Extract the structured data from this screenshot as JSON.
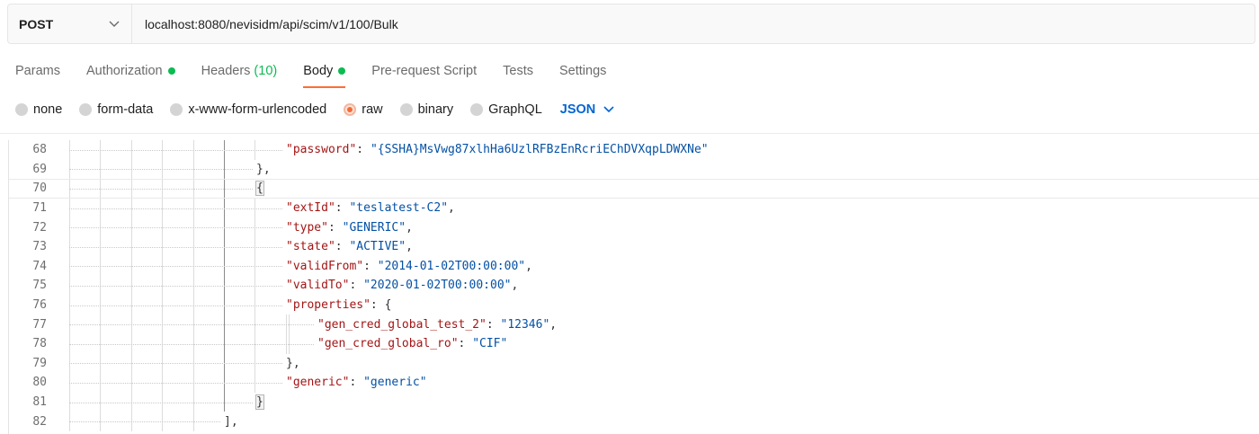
{
  "request": {
    "method": "POST",
    "url": "localhost:8080/nevisidm/api/scim/v1/100/Bulk"
  },
  "tabs": [
    {
      "label": "Params"
    },
    {
      "label": "Authorization",
      "dot": true
    },
    {
      "label": "Headers",
      "count": "(10)"
    },
    {
      "label": "Body",
      "dot": true,
      "active": true
    },
    {
      "label": "Pre-request Script"
    },
    {
      "label": "Tests"
    },
    {
      "label": "Settings"
    }
  ],
  "body_types": [
    {
      "label": "none"
    },
    {
      "label": "form-data"
    },
    {
      "label": "x-www-form-urlencoded"
    },
    {
      "label": "raw",
      "selected": true
    },
    {
      "label": "binary"
    },
    {
      "label": "GraphQL"
    }
  ],
  "format": "JSON",
  "editor": {
    "lines": [
      {
        "n": "68",
        "indent": 4,
        "tokens": [
          [
            "k",
            "\"password\""
          ],
          [
            "p",
            ": "
          ],
          [
            "s",
            "\"{SSHA}MsVwg87xlhHa6UzlRFBzEnRcriEChDVXqpLDWXNe\""
          ]
        ]
      },
      {
        "n": "69",
        "indent": 3,
        "tokens": [
          [
            "p",
            "},"
          ]
        ]
      },
      {
        "n": "70",
        "indent": 3,
        "tokens": [
          [
            "b",
            "{"
          ]
        ],
        "current": true
      },
      {
        "n": "71",
        "indent": 4,
        "tokens": [
          [
            "k",
            "\"extId\""
          ],
          [
            "p",
            ": "
          ],
          [
            "s",
            "\"teslatest-C2\""
          ],
          [
            "p",
            ","
          ]
        ]
      },
      {
        "n": "72",
        "indent": 4,
        "tokens": [
          [
            "k",
            "\"type\""
          ],
          [
            "p",
            ": "
          ],
          [
            "s",
            "\"GENERIC\""
          ],
          [
            "p",
            ","
          ]
        ]
      },
      {
        "n": "73",
        "indent": 4,
        "tokens": [
          [
            "k",
            "\"state\""
          ],
          [
            "p",
            ": "
          ],
          [
            "s",
            "\"ACTIVE\""
          ],
          [
            "p",
            ","
          ]
        ]
      },
      {
        "n": "74",
        "indent": 4,
        "tokens": [
          [
            "k",
            "\"validFrom\""
          ],
          [
            "p",
            ": "
          ],
          [
            "s",
            "\"2014-01-02T00:00:00\""
          ],
          [
            "p",
            ","
          ]
        ]
      },
      {
        "n": "75",
        "indent": 4,
        "tokens": [
          [
            "k",
            "\"validTo\""
          ],
          [
            "p",
            ": "
          ],
          [
            "s",
            "\"2020-01-02T00:00:00\""
          ],
          [
            "p",
            ","
          ]
        ]
      },
      {
        "n": "76",
        "indent": 4,
        "tokens": [
          [
            "k",
            "\"properties\""
          ],
          [
            "p",
            ": {"
          ]
        ]
      },
      {
        "n": "77",
        "indent": 5,
        "tokens": [
          [
            "k",
            "\"gen_cred_global_test_2\""
          ],
          [
            "p",
            ": "
          ],
          [
            "s",
            "\"12346\""
          ],
          [
            "p",
            ","
          ]
        ]
      },
      {
        "n": "78",
        "indent": 5,
        "tokens": [
          [
            "k",
            "\"gen_cred_global_ro\""
          ],
          [
            "p",
            ": "
          ],
          [
            "s",
            "\"CIF\""
          ]
        ]
      },
      {
        "n": "79",
        "indent": 4,
        "tokens": [
          [
            "p",
            "},"
          ]
        ]
      },
      {
        "n": "80",
        "indent": 4,
        "tokens": [
          [
            "k",
            "\"generic\""
          ],
          [
            "p",
            ": "
          ],
          [
            "s",
            "\"generic\""
          ]
        ]
      },
      {
        "n": "81",
        "indent": 3,
        "tokens": [
          [
            "b",
            "}"
          ]
        ]
      },
      {
        "n": "82",
        "indent": 2,
        "tokens": [
          [
            "p",
            "],"
          ]
        ]
      }
    ]
  },
  "icons": {
    "method_dropdown": "chevron-down-icon",
    "format_dropdown": "chevron-down-icon"
  },
  "colors": {
    "accent": "#ff6c37",
    "status_dot": "#0cbb52",
    "format_link": "#0265d2",
    "json_key": "#a31515",
    "json_string": "#0451a5"
  }
}
